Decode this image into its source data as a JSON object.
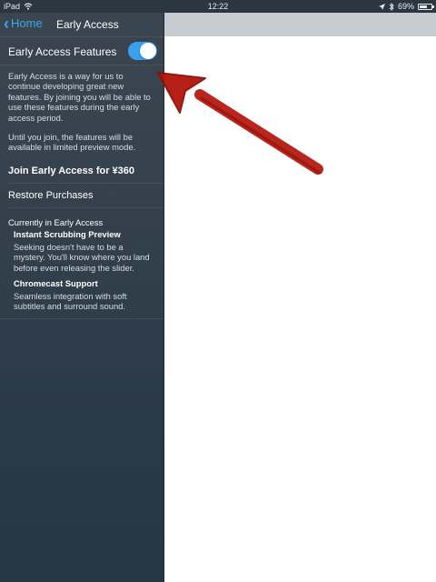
{
  "status_bar": {
    "device": "iPad",
    "time": "12:22",
    "battery": "69%",
    "battery_level": 0.69
  },
  "nav": {
    "back_label": "Home",
    "title": "Early Access"
  },
  "early_access": {
    "toggle_label": "Early Access Features",
    "toggle_on": true,
    "intro_text": "Early Access is a way for us to continue developing great new features. By joining you will be able to use these features during the early access period.",
    "until_text": "Until you join, the features will be available in limited preview mode.",
    "join_label": "Join Early Access for ¥360",
    "restore_label": "Restore Purchases"
  },
  "current": {
    "header": "Currently in Early Access",
    "features": [
      {
        "title": "Instant Scrubbing Preview",
        "description": "Seeking doesn't have to be a mystery. You'll know where you land before even releasing the slider."
      },
      {
        "title": "Chromecast Support",
        "description": "Seamless integration with soft subtitles and surround sound."
      }
    ]
  },
  "colors": {
    "accent": "#3aa8f2",
    "toggle_on": "#3aa0f0",
    "annotation_arrow": "#b3140a"
  },
  "icons": [
    "wifi-icon",
    "location-icon",
    "bluetooth-icon",
    "battery-icon",
    "chevron-left-icon",
    "annotation-arrow"
  ]
}
